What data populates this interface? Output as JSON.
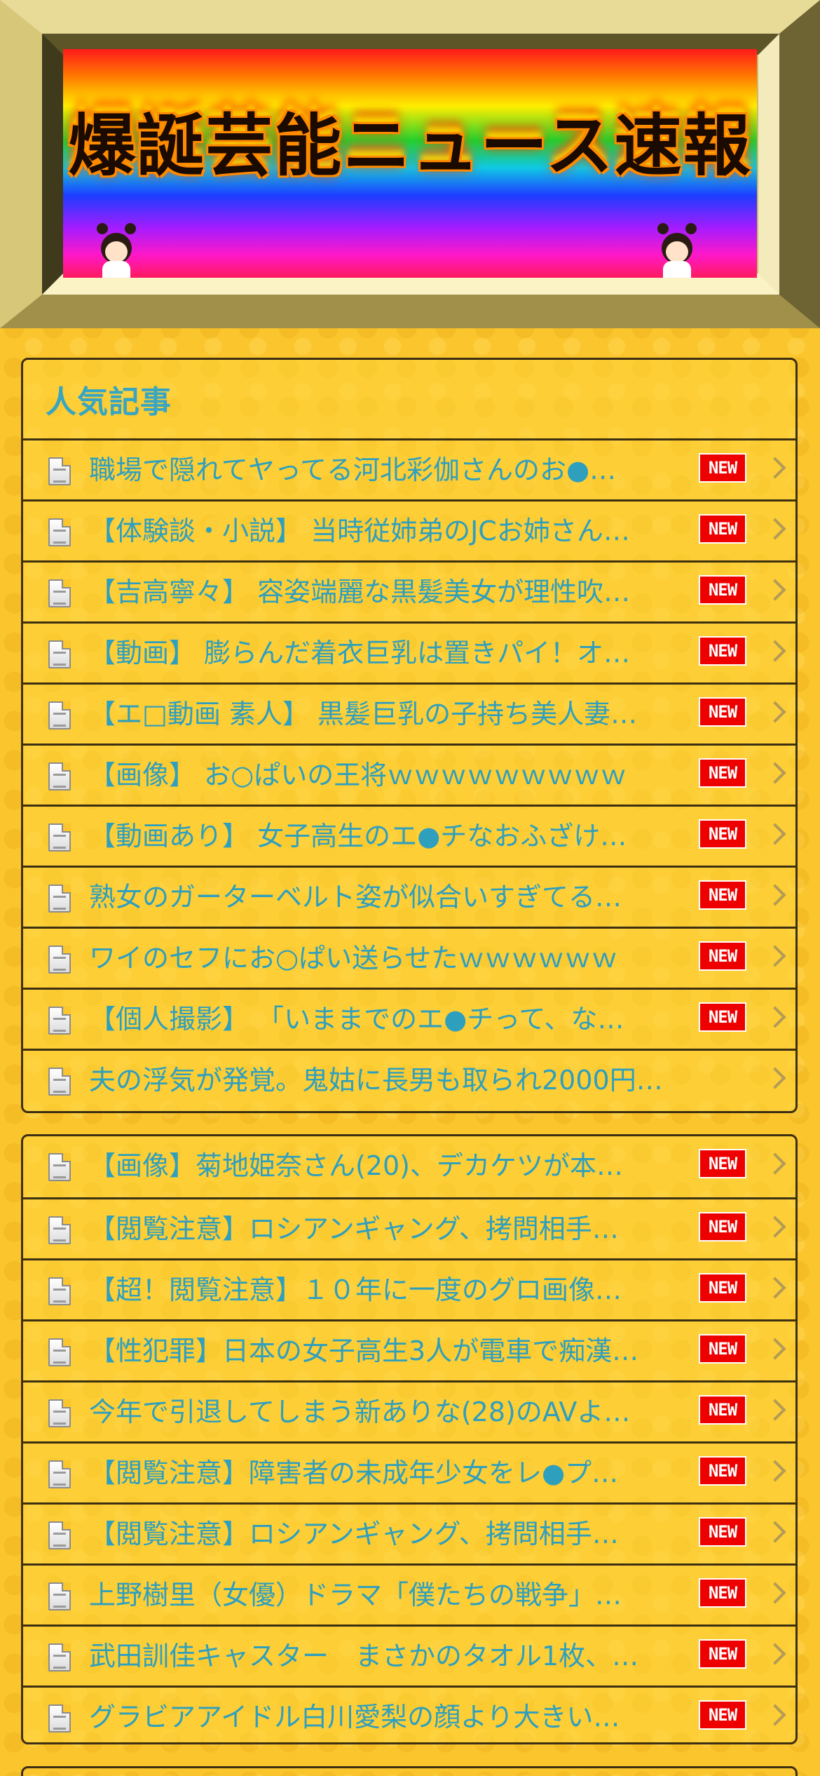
{
  "header": {
    "title": "爆誕芸能ニュース速報"
  },
  "popular": {
    "title": "人気記事",
    "badge_label": "NEW",
    "items": [
      {
        "title": "職場で隠れてヤってる河北彩伽さんのお●…",
        "new": true
      },
      {
        "title": "【体験談・小説】 当時従姉弟のJCお姉さん…",
        "new": true
      },
      {
        "title": "【吉高寧々】 容姿端麗な黒髪美女が理性吹…",
        "new": true
      },
      {
        "title": "【動画】 膨らんだ着衣巨乳は置きパイ！オ…",
        "new": true
      },
      {
        "title": "【エ□動画 素人】 黒髪巨乳の子持ち美人妻…",
        "new": true
      },
      {
        "title": "【画像】 お○ぱいの王将ｗｗｗｗｗｗｗｗｗ",
        "new": true
      },
      {
        "title": "【動画あり】 女子高生のエ●チなおふざけ…",
        "new": true
      },
      {
        "title": "熟女のガーターベルト姿が似合いすぎてる…",
        "new": true
      },
      {
        "title": "ワイのセフにお○ぱい送らせたｗｗｗｗｗｗ",
        "new": true
      },
      {
        "title": "【個人撮影】 「いままでのエ●チって、な…",
        "new": true
      },
      {
        "title": "夫の浮気が発覚。鬼姑に長男も取られ2000円…",
        "new": false
      }
    ]
  },
  "latest": {
    "badge_label": "NEW",
    "items": [
      {
        "title": "【画像】菊地姫奈さん(20)、デカケツが本…",
        "new": true
      },
      {
        "title": "【閲覧注意】ロシアンギャング、拷問相手…",
        "new": true
      },
      {
        "title": "【超！閲覧注意】１０年に一度のグロ画像…",
        "new": true
      },
      {
        "title": "【性犯罪】日本の女子高生3人が電車で痴漢…",
        "new": true
      },
      {
        "title": "今年で引退してしまう新ありな(28)のAVよ…",
        "new": true
      },
      {
        "title": "【閲覧注意】障害者の未成年少女をレ●プ…",
        "new": true
      },
      {
        "title": "【閲覧注意】ロシアンギャング、拷問相手…",
        "new": true
      },
      {
        "title": "上野樹里（女優）ドラマ「僕たちの戦争」…",
        "new": true
      },
      {
        "title": "武田訓佳キャスター　まさかのタオル1枚、…",
        "new": true
      },
      {
        "title": "グラビアアイドル白川愛梨の顔より大きい…",
        "new": true
      }
    ]
  },
  "icons": {
    "row_icon": "document-icon",
    "row_arrow": "chevron-right-icon",
    "badge_color": "#ee0000",
    "link_color": "#2f9fbe",
    "heading_color": "#38a5c2"
  }
}
